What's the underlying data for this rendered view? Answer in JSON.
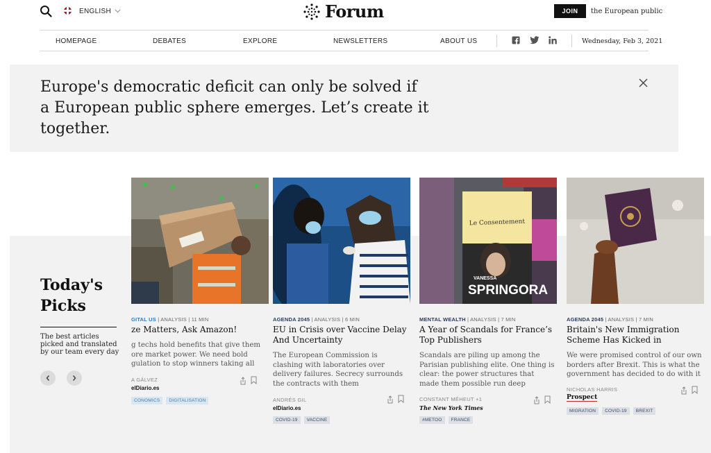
{
  "header": {
    "language": "ENGLISH",
    "logo_text": "Forum",
    "join_label": "JOIN",
    "tagline": "the European public"
  },
  "nav": {
    "items": [
      "HOMEPAGE",
      "DEBATES",
      "EXPLORE",
      "NEWSLETTERS",
      "ABOUT US"
    ],
    "date": "Wednesday, Feb 3, 2021",
    "social": [
      "facebook-icon",
      "twitter-icon",
      "linkedin-icon"
    ]
  },
  "banner": {
    "text": "Europe's democratic deficit can only be solved if a European public sphere emerges. Let’s create it together."
  },
  "picks": {
    "title": "Today's Picks",
    "description": "The best articles picked and translated by our team every day"
  },
  "cards": [
    {
      "tag": "GITAL US",
      "type": "ANALYSIS",
      "read_time": "11 MIN",
      "title": "ze Matters, Ask Amazon!",
      "description": "g techs hold benefits that give them ore market power. We need bold gulation to stop winners taking all",
      "author": "A GÁLVEZ",
      "source": "elDiario.es",
      "chips": [
        "CONOMICS",
        "DIGITALISATION"
      ]
    },
    {
      "tag": "AGENDA 2045",
      "type": "ANALYSIS",
      "read_time": "6 MIN",
      "title": "EU in Crisis over Vaccine Delay And Uncertainty",
      "description": "The European Commission is clashing with laboratories over delivery failures. Secrecy surrounds the contracts with them",
      "author": "ANDRÉS GIL",
      "source": "elDiario.es",
      "chips": [
        "COVID-19",
        "VACCINE"
      ]
    },
    {
      "tag": "MENTAL WEALTH",
      "type": "ANALYSIS",
      "read_time": "7 MIN",
      "title": "A Year of Scandals for France’s Top Publishers",
      "description": "Scandals are piling up among the Parisian publishing elite. One thing is clear: the power structures that made them possible run deep",
      "author": "CONSTANT MÉHEUT +1",
      "source": "The New York Times",
      "chips": [
        "#METOO",
        "FRANCE"
      ]
    },
    {
      "tag": "AGENDA 2045",
      "type": "ANALYSIS",
      "read_time": "7 MIN",
      "title": "Britain's New Immigration Scheme Has Kicked in",
      "description": "We were promised control of our own borders after Brexit. This is what the government has decided to do with it",
      "author": "NICHOLAS HARRIS",
      "source": "Prospect",
      "chips": [
        "MIGRATION",
        "COVID-19",
        "BREXIT"
      ]
    }
  ],
  "book_cover": {
    "title": "Le Consentement",
    "author_first": "VANESSA",
    "author_last": "SPRINGORA"
  },
  "colors": {
    "banner_bg": "#f2f2f2",
    "join_bg": "#111111",
    "chip_bg": "#dcdfe4",
    "kicker_blue": "#2c7bbf"
  }
}
